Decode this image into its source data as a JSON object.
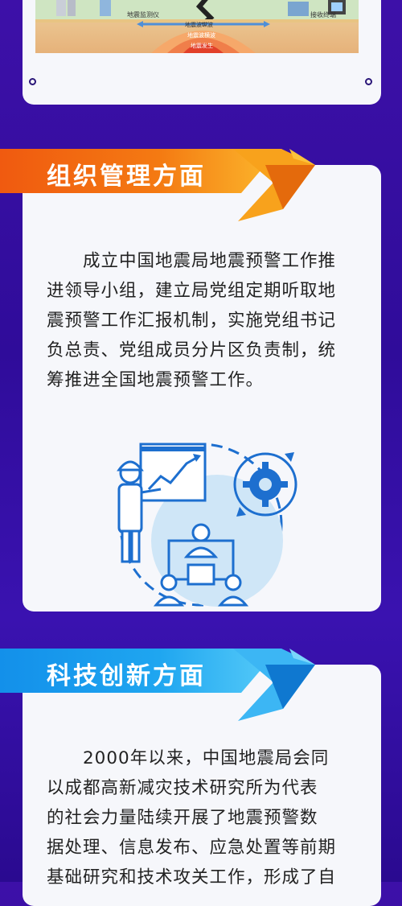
{
  "top_diagram": {
    "monitor_label": "地震监测仪",
    "terminal_label": "接收终端",
    "wave1": "地震波纵波",
    "wave2": "地震波横波",
    "quake": "地震发生"
  },
  "section1": {
    "title": "组织管理方面",
    "body": "　　成立中国地震局地震预警工作推\n进领导小组，建立局党组定期听取地\n震预警工作汇报机制，实施党组书记\n负总责、党组成员分片区负责制，统\n筹推进全国地震预警工作。"
  },
  "section2": {
    "title": "科技创新方面",
    "body": "　　2000年以来，中国地震局会同\n以成都高新减灾技术研究所为代表\n的社会力量陆续开展了地震预警数\n据处理、信息发布、应急处置等前期\n基础研究和技术攻关工作，形成了自"
  },
  "colors": {
    "background": "#3410a0",
    "banner_orange": "#f07a12",
    "banner_blue": "#1fa6f0",
    "icon_blue": "#2a7ed8"
  }
}
